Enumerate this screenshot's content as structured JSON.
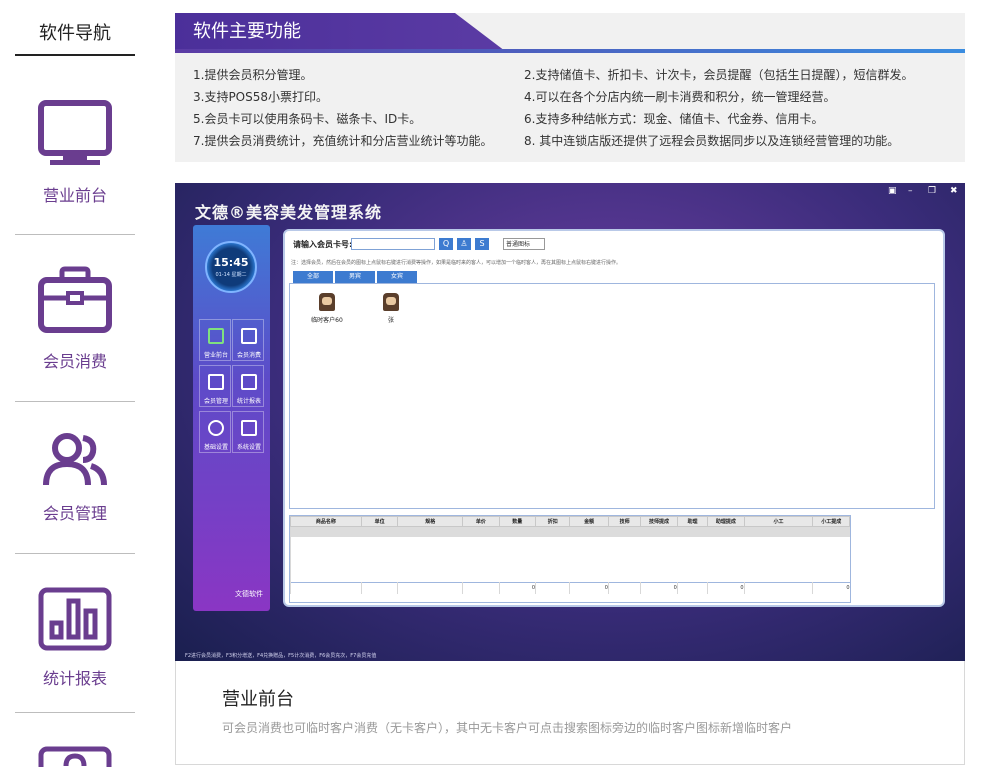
{
  "nav": {
    "title": "软件导航",
    "items": [
      {
        "label": "营业前台",
        "icon": "monitor-icon"
      },
      {
        "label": "会员消费",
        "icon": "briefcase-icon"
      },
      {
        "label": "会员管理",
        "icon": "users-icon"
      },
      {
        "label": "统计报表",
        "icon": "bar-chart-icon"
      },
      {
        "label": "",
        "icon": "gear-icon"
      }
    ],
    "accent_color": "#6a3d8f"
  },
  "features": {
    "title": "软件主要功能",
    "lines": [
      "1.提供会员积分管理。",
      "2.支持储值卡、折扣卡、计次卡，会员提醒（包括生日提醒），短信群发。",
      "3.支持POS58小票打印。",
      "4.可以在各个分店内统一刷卡消费和积分，统一管理经营。",
      "5.会员卡可以使用条码卡、磁条卡、ID卡。",
      "6.支持多种结帐方式：现金、储值卡、代金券、信用卡。",
      "7.提供会员消费统计，充值统计和分店营业统计等功能。",
      "8. 其中连锁店版还提供了远程会员数据同步以及连锁经营管理的功能。"
    ],
    "header_color": "#4b2f9a"
  },
  "screenshot": {
    "app_title": "文德®美容美发管理系统",
    "window_controls": [
      "▣",
      "–",
      "❐",
      "✖"
    ],
    "clock_time": "15:45",
    "clock_date": "01-14 星期二",
    "side_buttons": [
      "营业前台",
      "会员消费",
      "会员管理",
      "统计报表",
      "基础设置",
      "系统设置"
    ],
    "side_logo": "文德软件",
    "card_label": "请输入会员卡号:",
    "card_value": "",
    "query_buttons": [
      "Q",
      "♙",
      "S"
    ],
    "icon_mode": "普通图标",
    "note": "注：选择会员，然后在会员的图标上点鼠标右键进行消费等操作，如果是临时来的客人，可以增加一个临时客人，再在其图标上点鼠标右键进行操作。",
    "tabs": [
      "全部",
      "男宾",
      "女宾"
    ],
    "clients": [
      "临时客户60",
      "张"
    ],
    "grid_headers": [
      "商品名称",
      "单位",
      "规格",
      "单价",
      "数量",
      "折扣",
      "金额",
      "技师",
      "技师提成",
      "助理",
      "助理提成",
      "小工",
      "小工提成"
    ],
    "grid_totals": [
      "",
      "",
      "",
      "",
      "0",
      "",
      "0",
      "",
      "0",
      "",
      "0",
      "",
      "0"
    ],
    "status_bar": "F2进行会员消费，F3积分增送，F4兑换赠品，F5计次消费，F6会员充次，F7会员充值"
  },
  "caption": {
    "title": "营业前台",
    "description": "可会员消费也可临时客户消费（无卡客户），其中无卡客户可点击搜索图标旁边的临时客户图标新增临时客户"
  }
}
